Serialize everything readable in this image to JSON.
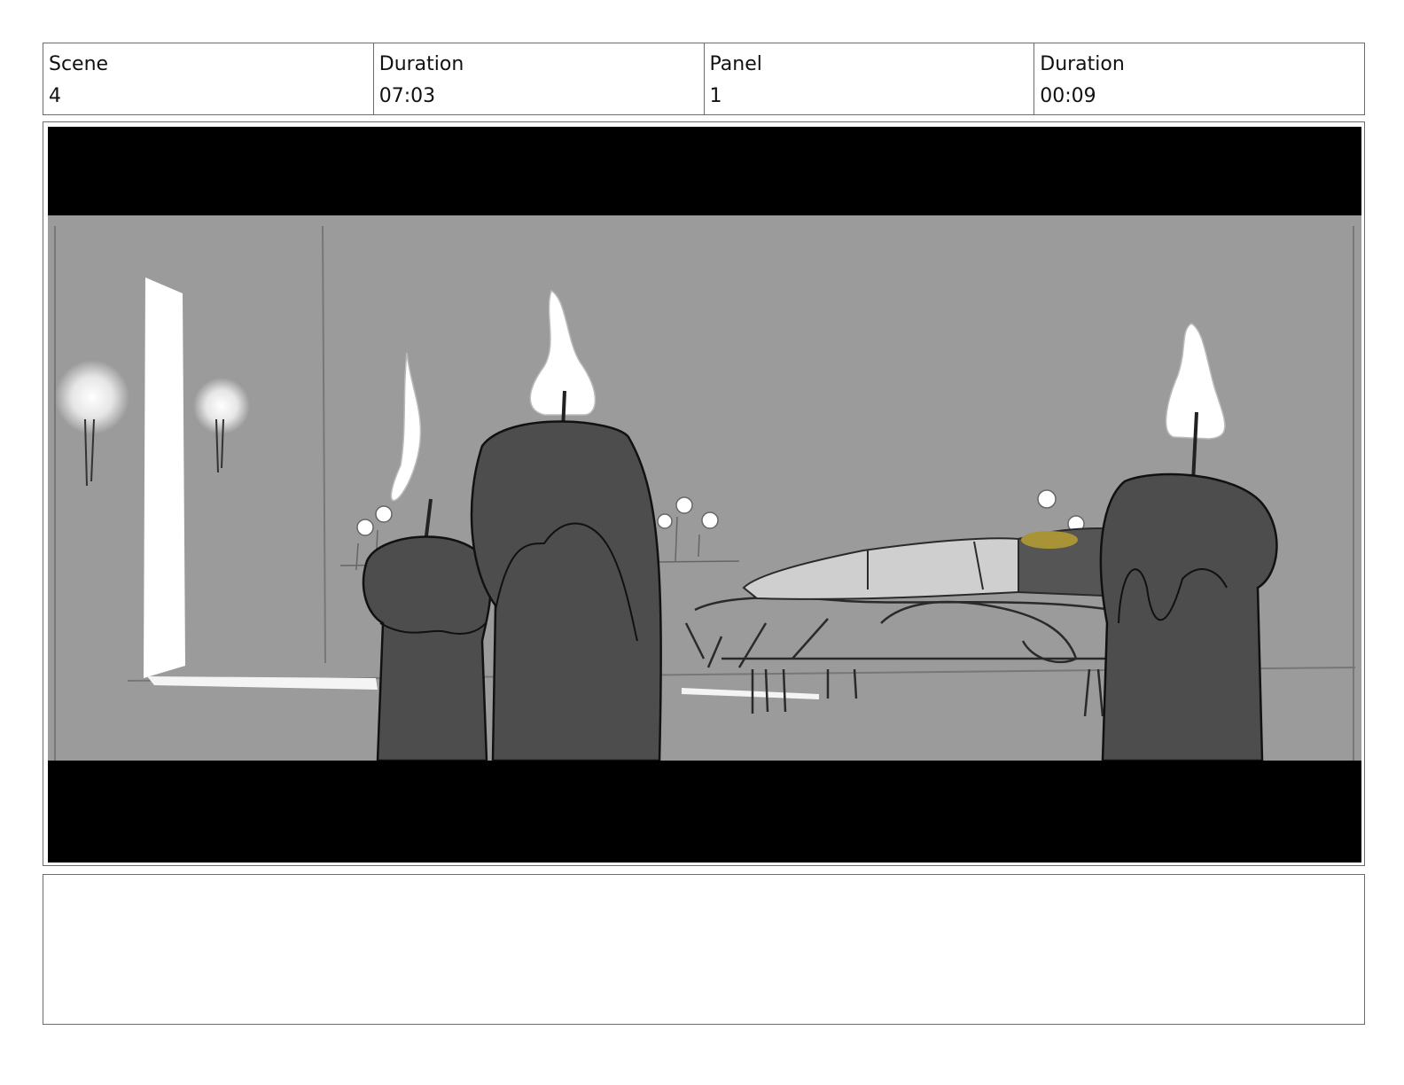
{
  "header": {
    "scene_label": "Scene",
    "scene_value": "4",
    "scene_duration_label": "Duration",
    "scene_duration_value": "07:03",
    "panel_label": "Panel",
    "panel_value": "1",
    "panel_duration_label": "Duration",
    "panel_duration_value": "00:09"
  },
  "panel": {
    "letterbox_color": "#000000",
    "background_color": "#9b9b9b"
  },
  "notes": {
    "text": ""
  }
}
